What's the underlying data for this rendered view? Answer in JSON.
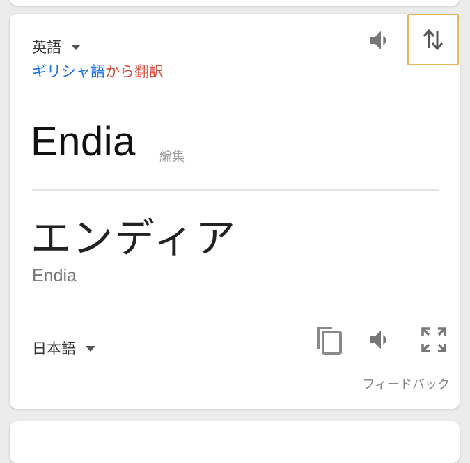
{
  "source_lang": {
    "label": "英語"
  },
  "detected": {
    "lang_link": "ギリシャ語",
    "suffix": "から翻訳"
  },
  "source_text": "Endia",
  "edit_label": "編集",
  "translated_text": "エンディア",
  "romanization": "Endia",
  "target_lang": {
    "label": "日本語"
  },
  "feedback_label": "フィードバック",
  "icons": {
    "speaker": "speaker-icon",
    "swap": "swap-vertical-icon",
    "copy": "copy-icon",
    "fullscreen": "fullscreen-icon",
    "dropdown": "caret-down-icon"
  },
  "colors": {
    "link_blue": "#1a73e8",
    "accent_red": "#d94a38",
    "focus_border": "#e8b65a"
  }
}
